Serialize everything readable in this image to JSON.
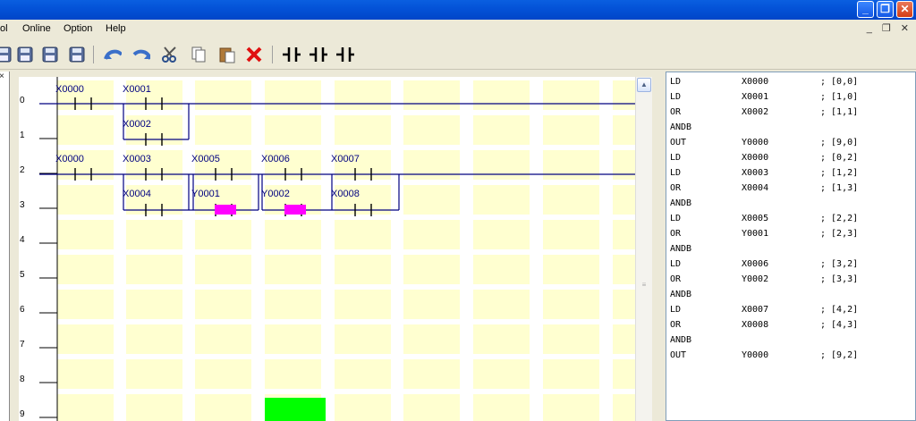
{
  "window": {
    "buttons": {
      "minimize": "_",
      "maximize": "❐",
      "close": "✕"
    },
    "mdi_controls": "_ ❐ ✕"
  },
  "menu": [
    "ol",
    "Online",
    "Option",
    "Help"
  ],
  "toolbar": {
    "icons": [
      "save-icon",
      "save-as-icon",
      "save-all-icon",
      "undo-icon",
      "redo-icon",
      "cut-icon",
      "copy-icon",
      "paste-icon",
      "delete-icon",
      "contact-no-icon",
      "contact-nc-icon",
      "contact-parallel-icon"
    ]
  },
  "ladder": {
    "row_numbers": [
      "0",
      "1",
      "2",
      "3",
      "4",
      "5",
      "6",
      "7",
      "8",
      "9"
    ],
    "labels": [
      {
        "text": "X0000",
        "col": 0,
        "row": 0
      },
      {
        "text": "X0001",
        "col": 1,
        "row": 0
      },
      {
        "text": "X0002",
        "col": 1,
        "row": 1
      },
      {
        "text": "X0000",
        "col": 0,
        "row": 2
      },
      {
        "text": "X0003",
        "col": 1,
        "row": 2
      },
      {
        "text": "X0005",
        "col": 2,
        "row": 2
      },
      {
        "text": "X0006",
        "col": 3,
        "row": 2
      },
      {
        "text": "X0007",
        "col": 4,
        "row": 2
      },
      {
        "text": "X0004",
        "col": 1,
        "row": 3
      },
      {
        "text": "Y0001",
        "col": 2,
        "row": 3
      },
      {
        "text": "Y0002",
        "col": 3,
        "row": 3
      },
      {
        "text": "X0008",
        "col": 4,
        "row": 3
      }
    ],
    "colors": {
      "cell": "#ffffd0",
      "line": "#000080",
      "label": "#000080",
      "marker": "#ff00ff",
      "cursor": "#00ff00"
    }
  },
  "instructions": [
    {
      "op": "LD",
      "arg": "X0000",
      "pos": "; [0,0]"
    },
    {
      "op": "LD",
      "arg": "X0001",
      "pos": "; [1,0]"
    },
    {
      "op": "OR",
      "arg": "X0002",
      "pos": "; [1,1]"
    },
    {
      "op": "ANDB",
      "arg": "",
      "pos": ""
    },
    {
      "op": "OUT",
      "arg": "Y0000",
      "pos": "; [9,0]"
    },
    {
      "op": "LD",
      "arg": "X0000",
      "pos": "; [0,2]"
    },
    {
      "op": "LD",
      "arg": "X0003",
      "pos": "; [1,2]"
    },
    {
      "op": "OR",
      "arg": "X0004",
      "pos": "; [1,3]"
    },
    {
      "op": "ANDB",
      "arg": "",
      "pos": ""
    },
    {
      "op": "LD",
      "arg": "X0005",
      "pos": "; [2,2]"
    },
    {
      "op": "OR",
      "arg": "Y0001",
      "pos": "; [2,3]"
    },
    {
      "op": "ANDB",
      "arg": "",
      "pos": ""
    },
    {
      "op": "LD",
      "arg": "X0006",
      "pos": "; [3,2]"
    },
    {
      "op": "OR",
      "arg": "Y0002",
      "pos": "; [3,3]"
    },
    {
      "op": "ANDB",
      "arg": "",
      "pos": ""
    },
    {
      "op": "LD",
      "arg": "X0007",
      "pos": "; [4,2]"
    },
    {
      "op": "OR",
      "arg": "X0008",
      "pos": "; [4,3]"
    },
    {
      "op": "ANDB",
      "arg": "",
      "pos": ""
    },
    {
      "op": "OUT",
      "arg": "Y0000",
      "pos": "; [9,2]"
    }
  ]
}
